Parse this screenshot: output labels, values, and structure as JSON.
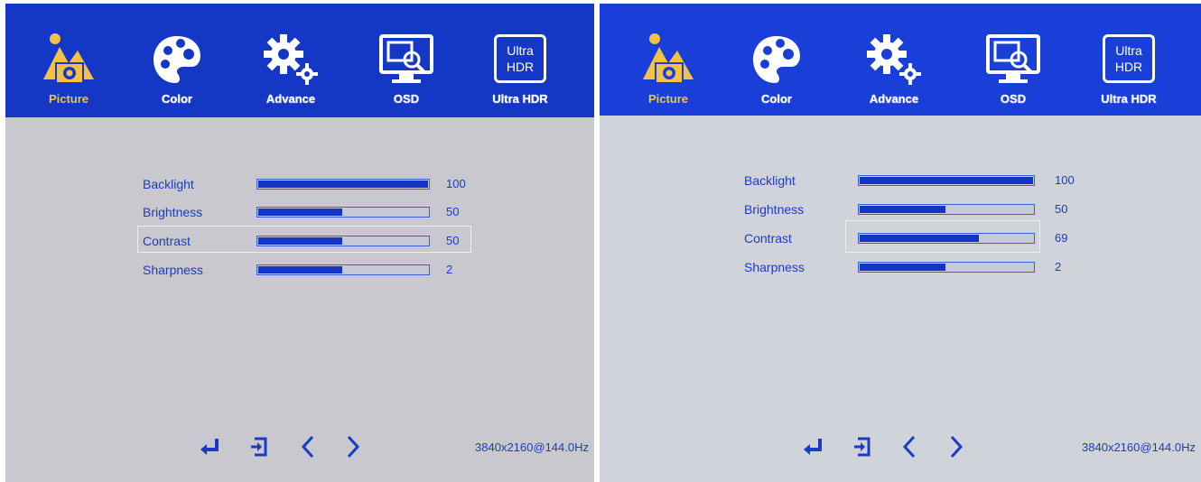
{
  "screens": [
    {
      "id": "left",
      "tabs": [
        {
          "label": "Picture",
          "icon": "picture-icon",
          "active": true
        },
        {
          "label": "Color",
          "icon": "palette-icon",
          "active": false
        },
        {
          "label": "Advance",
          "icon": "gear-icon",
          "active": false
        },
        {
          "label": "OSD",
          "icon": "osd-monitor-icon",
          "active": false
        },
        {
          "label": "Ultra HDR",
          "icon": "ultra-hdr-icon",
          "icon_text": [
            "Ultra",
            "HDR"
          ],
          "active": false
        }
      ],
      "settings": [
        {
          "label": "Backlight",
          "value": "100",
          "level": 100
        },
        {
          "label": "Brightness",
          "value": "50",
          "level": 50
        },
        {
          "label": "Contrast",
          "value": "50",
          "level": 50,
          "selected": true
        },
        {
          "label": "Sharpness",
          "value": "2",
          "level": 50
        }
      ],
      "nav_icons": [
        "enter-icon",
        "exit-icon",
        "left-arrow-icon",
        "right-arrow-icon"
      ],
      "resolution": "3840x2160@144.0Hz"
    },
    {
      "id": "right",
      "tabs": [
        {
          "label": "Picture",
          "icon": "picture-icon",
          "active": true
        },
        {
          "label": "Color",
          "icon": "palette-icon",
          "active": false
        },
        {
          "label": "Advance",
          "icon": "gear-icon",
          "active": false
        },
        {
          "label": "OSD",
          "icon": "osd-monitor-icon",
          "active": false
        },
        {
          "label": "Ultra HDR",
          "icon": "ultra-hdr-icon",
          "icon_text": [
            "Ultra",
            "HDR"
          ],
          "active": false
        }
      ],
      "settings": [
        {
          "label": "Backlight",
          "value": "100",
          "level": 100
        },
        {
          "label": "Brightness",
          "value": "50",
          "level": 50
        },
        {
          "label": "Contrast",
          "value": "69",
          "level": 69,
          "selected": true
        },
        {
          "label": "Sharpness",
          "value": "2",
          "level": 50
        }
      ],
      "nav_icons": [
        "enter-icon",
        "exit-icon",
        "left-arrow-icon",
        "right-arrow-icon"
      ],
      "resolution": "3840x2160@144.0Hz"
    }
  ],
  "colors": {
    "header_blue": "#1437c6",
    "active_tab_gold": "#f3c146",
    "text_blue": "#1b3bc4",
    "bar_fill": "#1434c3"
  }
}
